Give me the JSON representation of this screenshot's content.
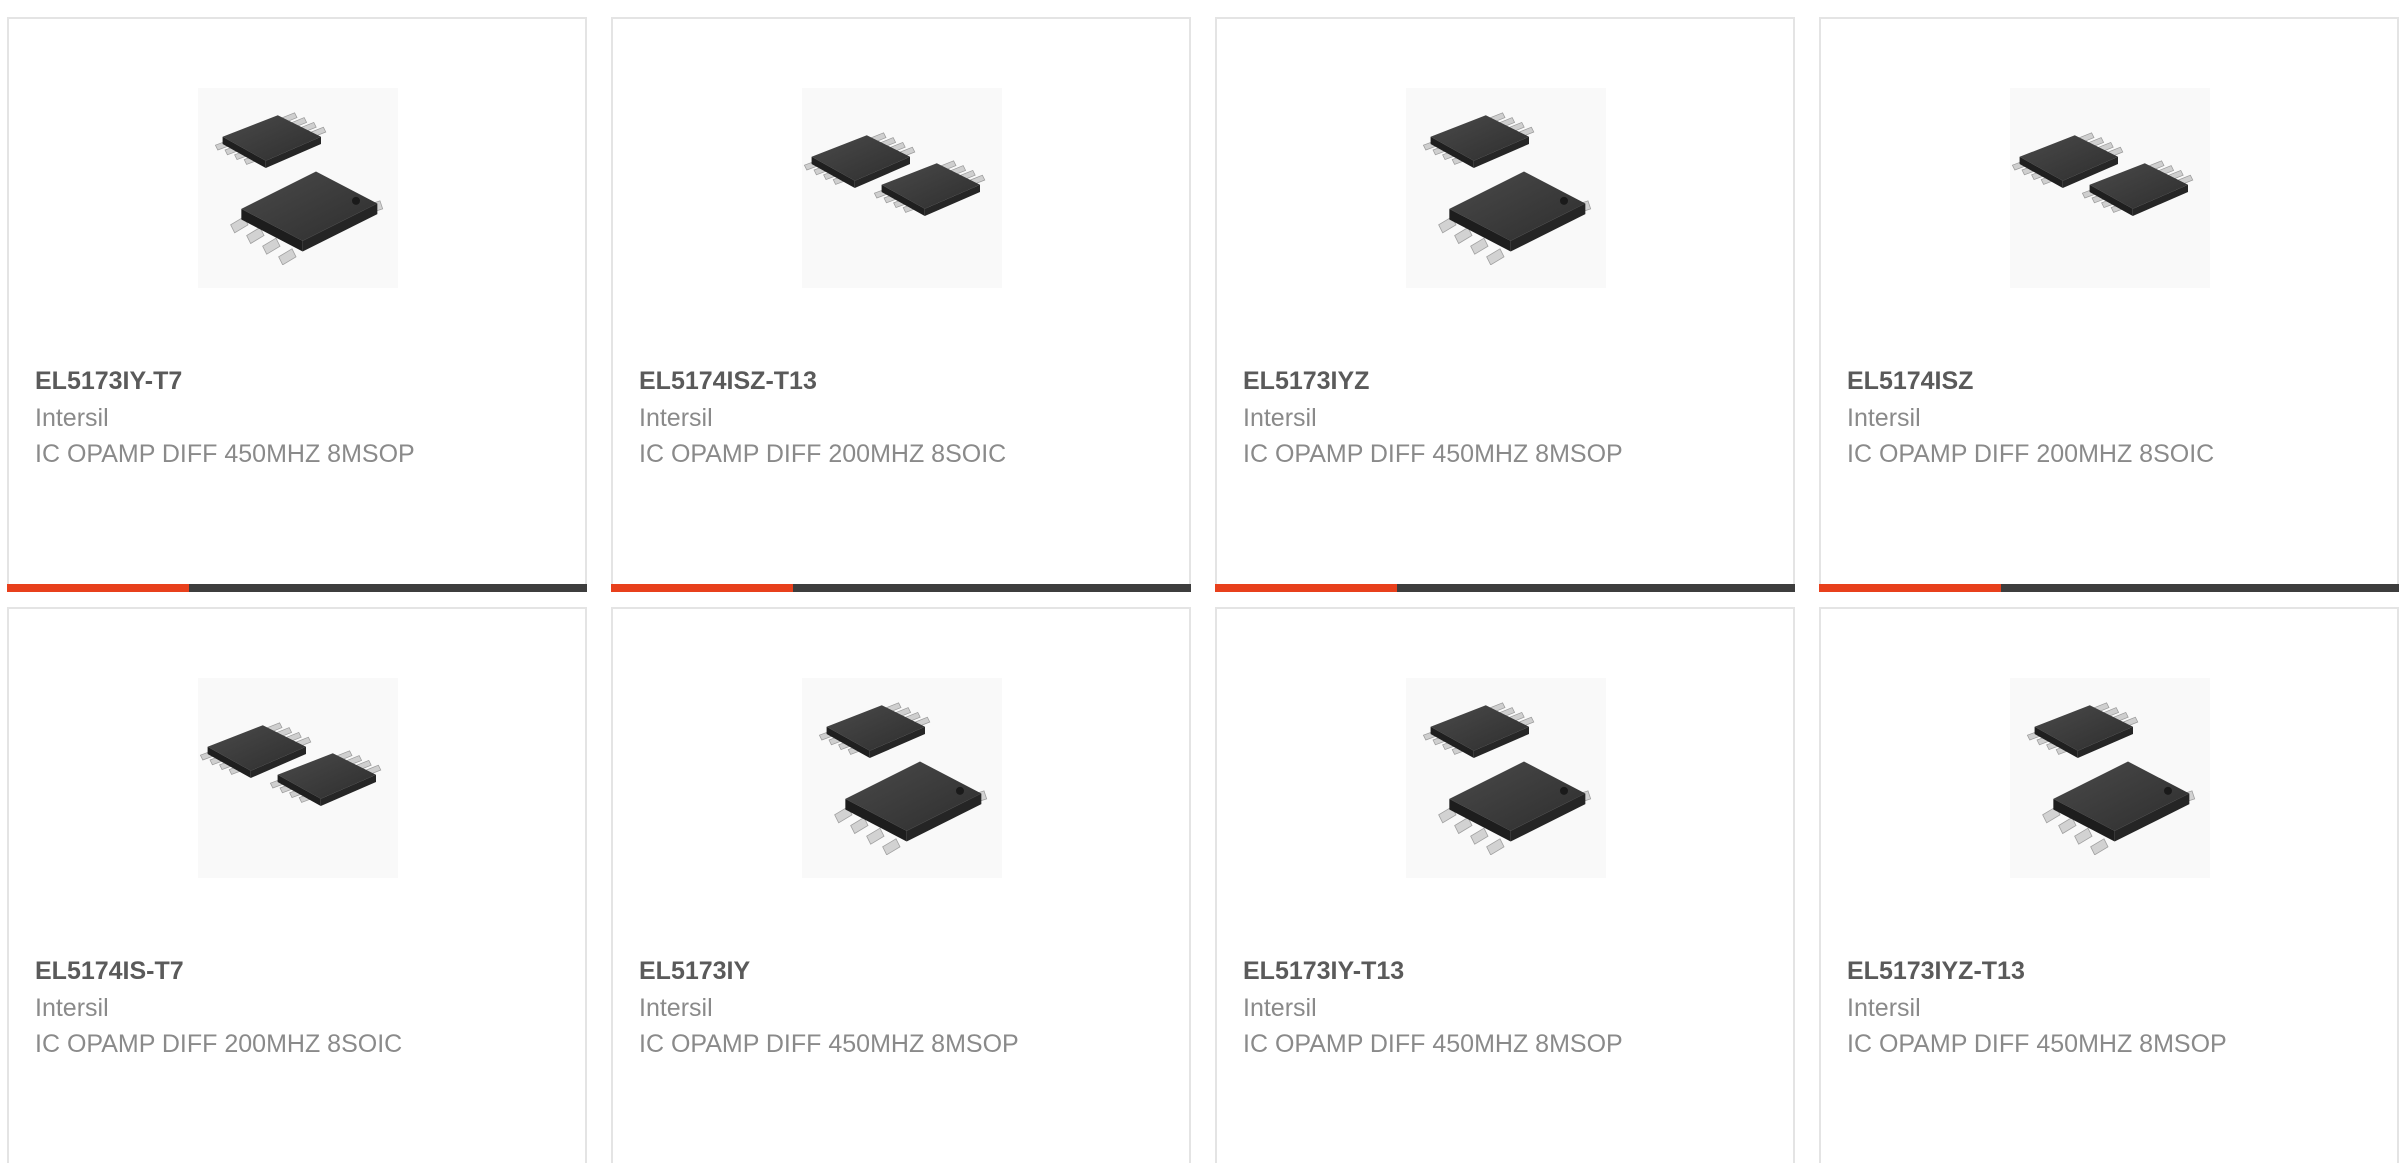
{
  "accent_color": "#e8401c",
  "products": [
    {
      "part_number": "EL5173IY-T7",
      "manufacturer": "Intersil",
      "description": "IC OPAMP DIFF 450MHZ 8MSOP",
      "image": "msop-8-package-icon"
    },
    {
      "part_number": "EL5174ISZ-T13",
      "manufacturer": "Intersil",
      "description": "IC OPAMP DIFF 200MHZ 8SOIC",
      "image": "soic-8-package-icon"
    },
    {
      "part_number": "EL5173IYZ",
      "manufacturer": "Intersil",
      "description": "IC OPAMP DIFF 450MHZ 8MSOP",
      "image": "msop-8-package-icon"
    },
    {
      "part_number": "EL5174ISZ",
      "manufacturer": "Intersil",
      "description": "IC OPAMP DIFF 200MHZ 8SOIC",
      "image": "soic-8-package-icon"
    },
    {
      "part_number": "EL5174IS-T7",
      "manufacturer": "Intersil",
      "description": "IC OPAMP DIFF 200MHZ 8SOIC",
      "image": "soic-8-package-icon"
    },
    {
      "part_number": "EL5173IY",
      "manufacturer": "Intersil",
      "description": "IC OPAMP DIFF 450MHZ 8MSOP",
      "image": "msop-8-package-icon"
    },
    {
      "part_number": "EL5173IY-T13",
      "manufacturer": "Intersil",
      "description": "IC OPAMP DIFF 450MHZ 8MSOP",
      "image": "msop-8-package-icon"
    },
    {
      "part_number": "EL5173IYZ-T13",
      "manufacturer": "Intersil",
      "description": "IC OPAMP DIFF 450MHZ 8MSOP",
      "image": "msop-8-package-icon"
    }
  ]
}
